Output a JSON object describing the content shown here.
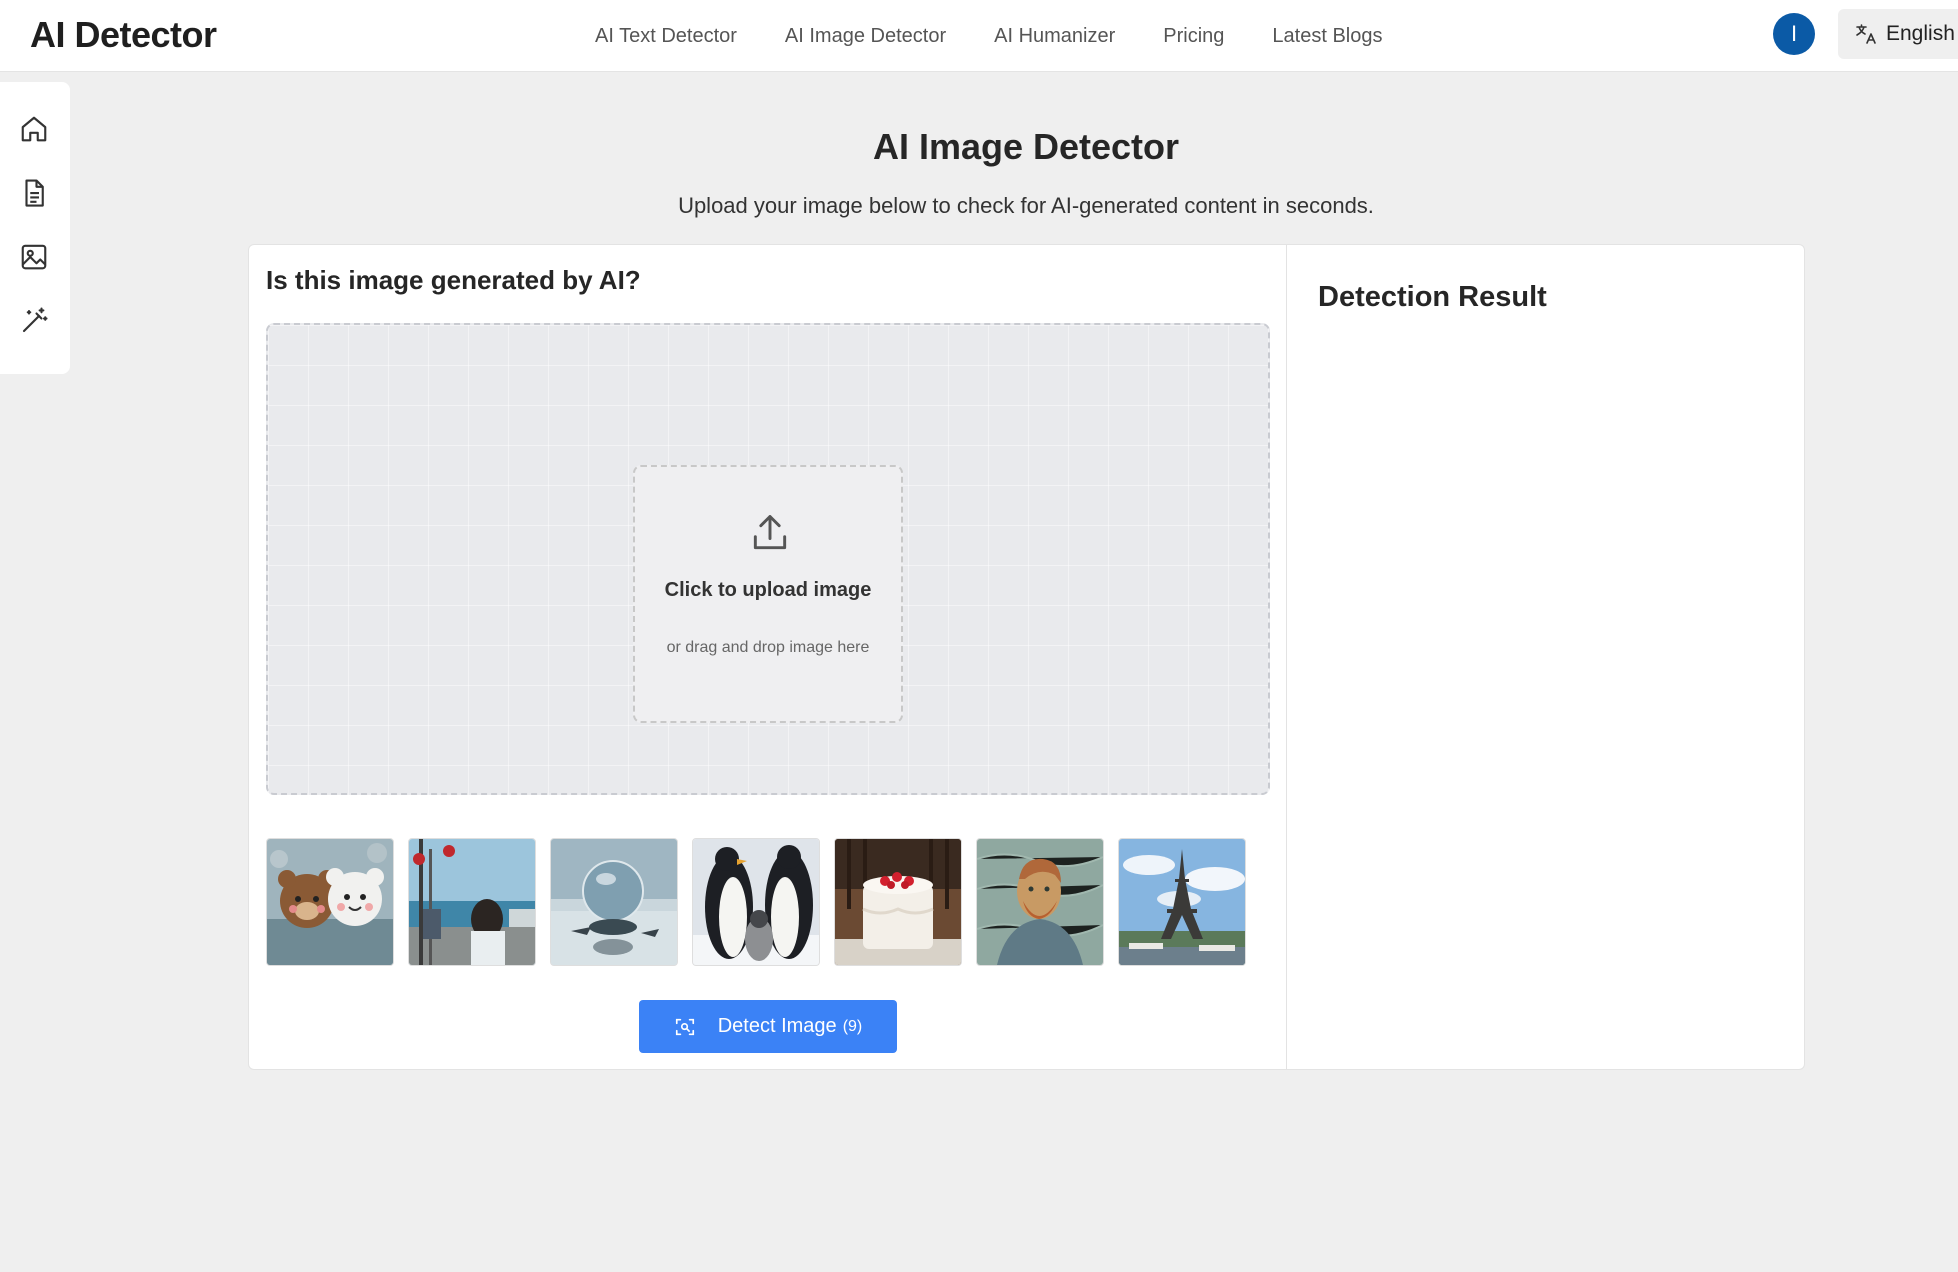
{
  "header": {
    "brand": "AI Detector",
    "nav": [
      "AI Text Detector",
      "AI Image Detector",
      "AI Humanizer",
      "Pricing",
      "Latest Blogs"
    ],
    "avatar_initial": "I",
    "language": "English"
  },
  "sidebar": {
    "items": [
      {
        "icon": "home-icon"
      },
      {
        "icon": "document-icon"
      },
      {
        "icon": "image-icon"
      },
      {
        "icon": "magic-wand-icon"
      }
    ]
  },
  "main": {
    "title": "AI Image Detector",
    "subtitle": "Upload your image below to check for AI-generated content in seconds."
  },
  "detector": {
    "question": "Is this image generated by AI?",
    "upload_main": "Click to upload image",
    "upload_sub": "or drag and drop image here",
    "samples": [
      {
        "icon": "bears-thumbnail"
      },
      {
        "icon": "girl-at-sea-thumbnail"
      },
      {
        "icon": "crystal-ball-thumbnail"
      },
      {
        "icon": "penguins-thumbnail"
      },
      {
        "icon": "cake-thumbnail"
      },
      {
        "icon": "portrait-painting-thumbnail"
      },
      {
        "icon": "eiffel-tower-thumbnail"
      }
    ],
    "detect_button": "Detect Image",
    "detect_count": "(9)"
  },
  "result": {
    "title": "Detection Result"
  },
  "colors": {
    "accent": "#3b82f6",
    "avatar": "#0b5aa6",
    "background": "#efefef"
  }
}
